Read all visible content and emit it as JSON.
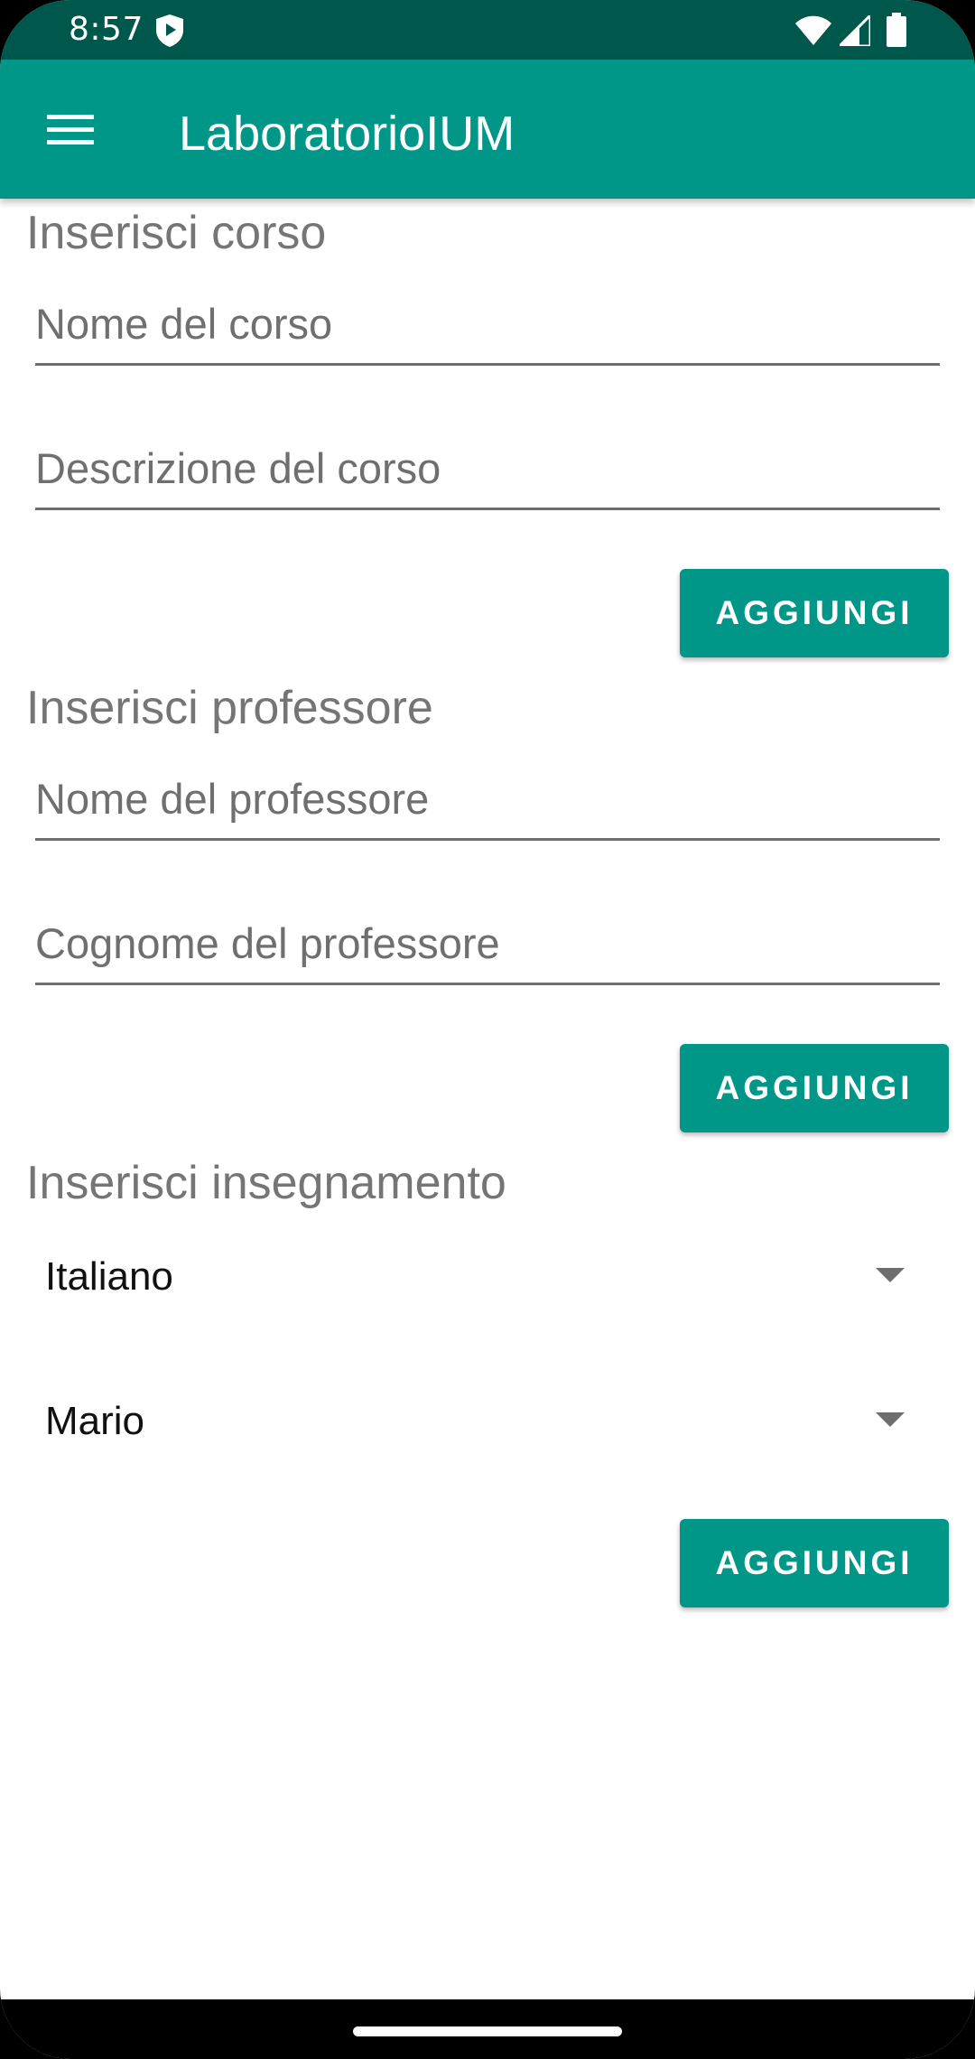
{
  "status_bar": {
    "time": "8:57"
  },
  "app_bar": {
    "title": "LaboratorioIUM"
  },
  "corso": {
    "title": "Inserisci corso",
    "name_placeholder": "Nome del corso",
    "description_placeholder": "Descrizione del corso",
    "button_label": "AGGIUNGI"
  },
  "professore": {
    "title": "Inserisci professore",
    "name_placeholder": "Nome del professore",
    "surname_placeholder": "Cognome del professore",
    "button_label": "AGGIUNGI"
  },
  "insegnamento": {
    "title": "Inserisci insegnamento",
    "course_selected": "Italiano",
    "professor_selected": "Mario",
    "button_label": "AGGIUNGI"
  },
  "colors": {
    "primary": "#009688",
    "primary_dark": "#00574b"
  }
}
